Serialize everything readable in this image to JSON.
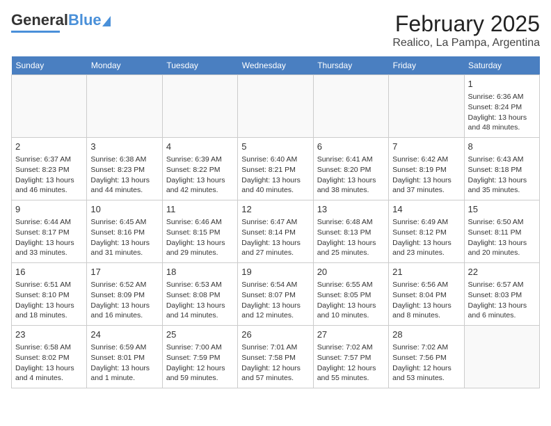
{
  "logo": {
    "text1": "General",
    "text2": "Blue"
  },
  "title": "February 2025",
  "subtitle": "Realico, La Pampa, Argentina",
  "days_of_week": [
    "Sunday",
    "Monday",
    "Tuesday",
    "Wednesday",
    "Thursday",
    "Friday",
    "Saturday"
  ],
  "weeks": [
    [
      {
        "day": "",
        "info": ""
      },
      {
        "day": "",
        "info": ""
      },
      {
        "day": "",
        "info": ""
      },
      {
        "day": "",
        "info": ""
      },
      {
        "day": "",
        "info": ""
      },
      {
        "day": "",
        "info": ""
      },
      {
        "day": "1",
        "info": "Sunrise: 6:36 AM\nSunset: 8:24 PM\nDaylight: 13 hours and 48 minutes."
      }
    ],
    [
      {
        "day": "2",
        "info": "Sunrise: 6:37 AM\nSunset: 8:23 PM\nDaylight: 13 hours and 46 minutes."
      },
      {
        "day": "3",
        "info": "Sunrise: 6:38 AM\nSunset: 8:23 PM\nDaylight: 13 hours and 44 minutes."
      },
      {
        "day": "4",
        "info": "Sunrise: 6:39 AM\nSunset: 8:22 PM\nDaylight: 13 hours and 42 minutes."
      },
      {
        "day": "5",
        "info": "Sunrise: 6:40 AM\nSunset: 8:21 PM\nDaylight: 13 hours and 40 minutes."
      },
      {
        "day": "6",
        "info": "Sunrise: 6:41 AM\nSunset: 8:20 PM\nDaylight: 13 hours and 38 minutes."
      },
      {
        "day": "7",
        "info": "Sunrise: 6:42 AM\nSunset: 8:19 PM\nDaylight: 13 hours and 37 minutes."
      },
      {
        "day": "8",
        "info": "Sunrise: 6:43 AM\nSunset: 8:18 PM\nDaylight: 13 hours and 35 minutes."
      }
    ],
    [
      {
        "day": "9",
        "info": "Sunrise: 6:44 AM\nSunset: 8:17 PM\nDaylight: 13 hours and 33 minutes."
      },
      {
        "day": "10",
        "info": "Sunrise: 6:45 AM\nSunset: 8:16 PM\nDaylight: 13 hours and 31 minutes."
      },
      {
        "day": "11",
        "info": "Sunrise: 6:46 AM\nSunset: 8:15 PM\nDaylight: 13 hours and 29 minutes."
      },
      {
        "day": "12",
        "info": "Sunrise: 6:47 AM\nSunset: 8:14 PM\nDaylight: 13 hours and 27 minutes."
      },
      {
        "day": "13",
        "info": "Sunrise: 6:48 AM\nSunset: 8:13 PM\nDaylight: 13 hours and 25 minutes."
      },
      {
        "day": "14",
        "info": "Sunrise: 6:49 AM\nSunset: 8:12 PM\nDaylight: 13 hours and 23 minutes."
      },
      {
        "day": "15",
        "info": "Sunrise: 6:50 AM\nSunset: 8:11 PM\nDaylight: 13 hours and 20 minutes."
      }
    ],
    [
      {
        "day": "16",
        "info": "Sunrise: 6:51 AM\nSunset: 8:10 PM\nDaylight: 13 hours and 18 minutes."
      },
      {
        "day": "17",
        "info": "Sunrise: 6:52 AM\nSunset: 8:09 PM\nDaylight: 13 hours and 16 minutes."
      },
      {
        "day": "18",
        "info": "Sunrise: 6:53 AM\nSunset: 8:08 PM\nDaylight: 13 hours and 14 minutes."
      },
      {
        "day": "19",
        "info": "Sunrise: 6:54 AM\nSunset: 8:07 PM\nDaylight: 13 hours and 12 minutes."
      },
      {
        "day": "20",
        "info": "Sunrise: 6:55 AM\nSunset: 8:05 PM\nDaylight: 13 hours and 10 minutes."
      },
      {
        "day": "21",
        "info": "Sunrise: 6:56 AM\nSunset: 8:04 PM\nDaylight: 13 hours and 8 minutes."
      },
      {
        "day": "22",
        "info": "Sunrise: 6:57 AM\nSunset: 8:03 PM\nDaylight: 13 hours and 6 minutes."
      }
    ],
    [
      {
        "day": "23",
        "info": "Sunrise: 6:58 AM\nSunset: 8:02 PM\nDaylight: 13 hours and 4 minutes."
      },
      {
        "day": "24",
        "info": "Sunrise: 6:59 AM\nSunset: 8:01 PM\nDaylight: 13 hours and 1 minute."
      },
      {
        "day": "25",
        "info": "Sunrise: 7:00 AM\nSunset: 7:59 PM\nDaylight: 12 hours and 59 minutes."
      },
      {
        "day": "26",
        "info": "Sunrise: 7:01 AM\nSunset: 7:58 PM\nDaylight: 12 hours and 57 minutes."
      },
      {
        "day": "27",
        "info": "Sunrise: 7:02 AM\nSunset: 7:57 PM\nDaylight: 12 hours and 55 minutes."
      },
      {
        "day": "28",
        "info": "Sunrise: 7:02 AM\nSunset: 7:56 PM\nDaylight: 12 hours and 53 minutes."
      },
      {
        "day": "",
        "info": ""
      }
    ]
  ]
}
